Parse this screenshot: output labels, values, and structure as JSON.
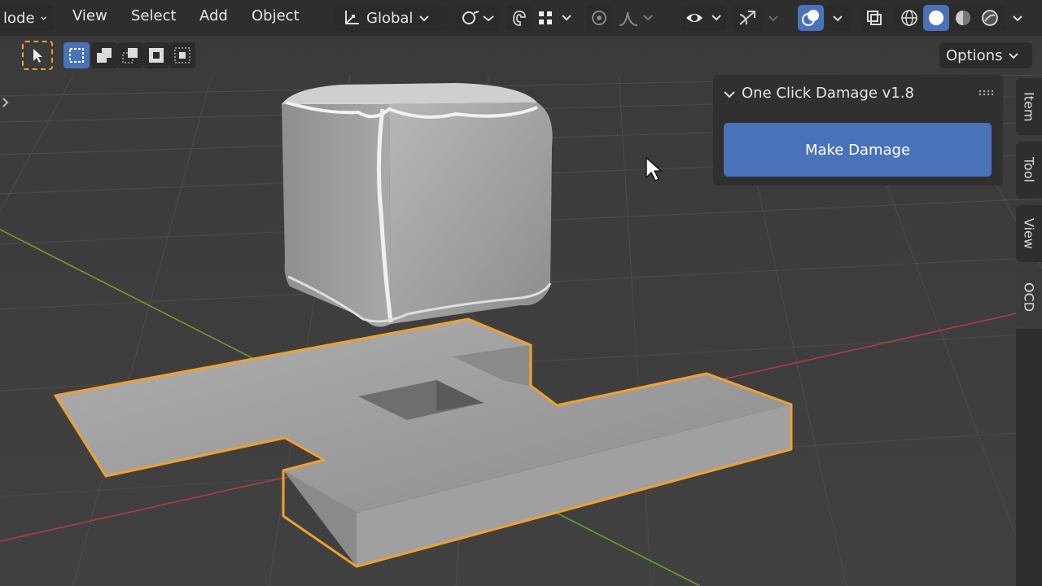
{
  "header": {
    "mode_label": "lode",
    "menus": [
      "View",
      "Select",
      "Add",
      "Object"
    ],
    "orientation_label": "Global"
  },
  "toolbar": {
    "options_label": "Options"
  },
  "panel": {
    "title": "One Click Damage v1.8",
    "button_label": "Make Damage"
  },
  "sidebar_tabs": [
    "Item",
    "Tool",
    "View",
    "OCD"
  ],
  "active_tab": "OCD",
  "colors": {
    "accent": "#4a72b8",
    "selection_outline": "#f0a030",
    "x_axis": "#b13a4a",
    "y_axis": "#6f9a31",
    "background": "#3d3d3d"
  }
}
